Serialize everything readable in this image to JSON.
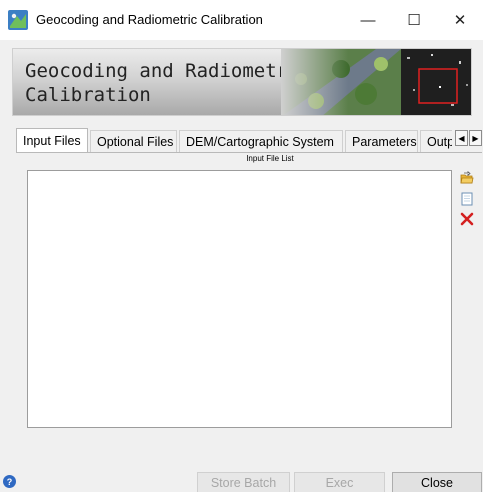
{
  "window": {
    "title": "Geocoding and Radiometric Calibration",
    "controls": {
      "minimize": "—",
      "maximize": "☐",
      "close": "✕"
    }
  },
  "banner": {
    "title": "Geocoding and Radiometric Calibration"
  },
  "tabs": [
    {
      "label": "Input Files",
      "active": true
    },
    {
      "label": "Optional Files",
      "active": false
    },
    {
      "label": "DEM/Cartographic System",
      "active": false
    },
    {
      "label": "Parameters",
      "active": false
    },
    {
      "label": "Outp",
      "active": false
    }
  ],
  "tab_scroll": {
    "left": "◀",
    "right": "▶"
  },
  "input_files": {
    "list_label": "Input File List",
    "files": []
  },
  "footer": {
    "help": "?",
    "store_batch": "Store Batch",
    "exec": "Exec",
    "close": "Close"
  },
  "colors": {
    "help_icon": "#2f69c2",
    "delete_icon": "#d42020",
    "folder_icon": "#e8b43a",
    "roi_box": "#e02020",
    "disabled_text": "#a7a7a7"
  },
  "icons": {
    "app": "sar-satellite-icon",
    "open": "folder-open-icon",
    "new": "new-list-icon",
    "delete": "delete-x-icon"
  }
}
